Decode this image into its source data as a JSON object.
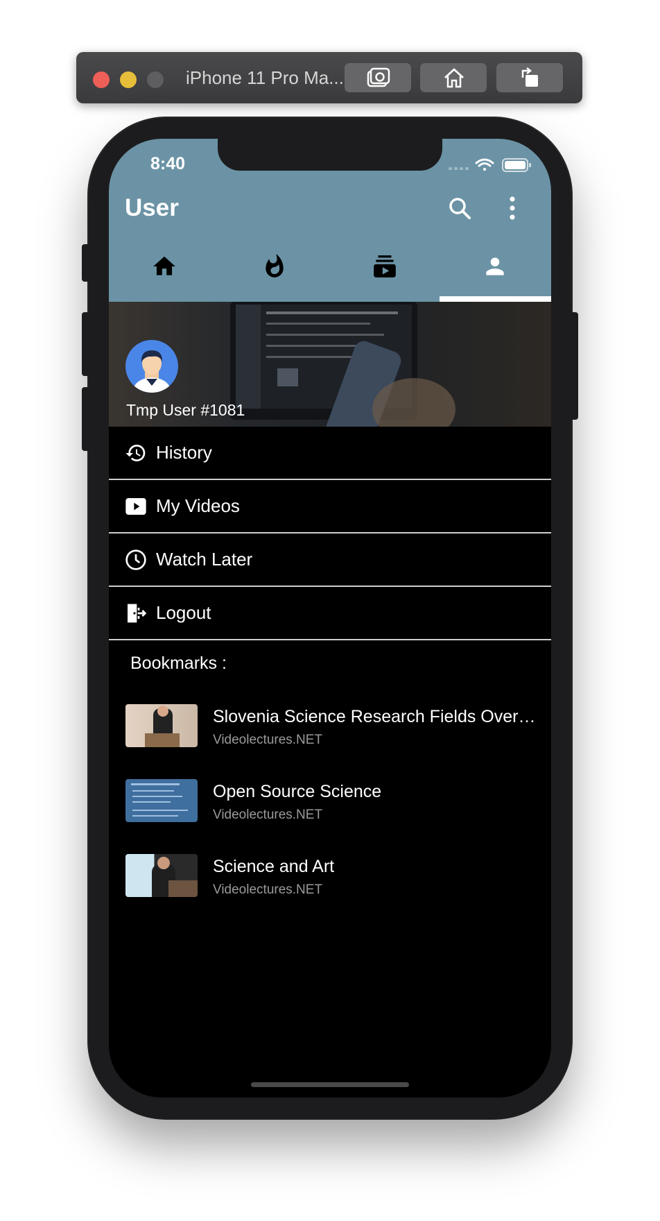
{
  "simulator": {
    "device_title": "iPhone 11 Pro Ma...",
    "buttons": [
      "screenshot",
      "home",
      "rotate"
    ]
  },
  "status_bar": {
    "time": "8:40"
  },
  "header": {
    "title": "User",
    "color": "#6b93a5",
    "tabs": [
      "home",
      "trending",
      "subscriptions",
      "user"
    ],
    "active_tab": "user"
  },
  "profile": {
    "username": "Tmp User #1081"
  },
  "menu": [
    {
      "label": "History",
      "icon": "history-icon"
    },
    {
      "label": "My Videos",
      "icon": "video-icon"
    },
    {
      "label": "Watch Later",
      "icon": "clock-icon"
    },
    {
      "label": "Logout",
      "icon": "logout-icon"
    }
  ],
  "bookmarks": {
    "heading": "Bookmarks :",
    "items": [
      {
        "title": "Slovenia Science Research Fields Overvi...",
        "source": "Videolectures.NET"
      },
      {
        "title": "Open Source Science",
        "source": "Videolectures.NET"
      },
      {
        "title": "Science and Art",
        "source": "Videolectures.NET"
      }
    ]
  }
}
